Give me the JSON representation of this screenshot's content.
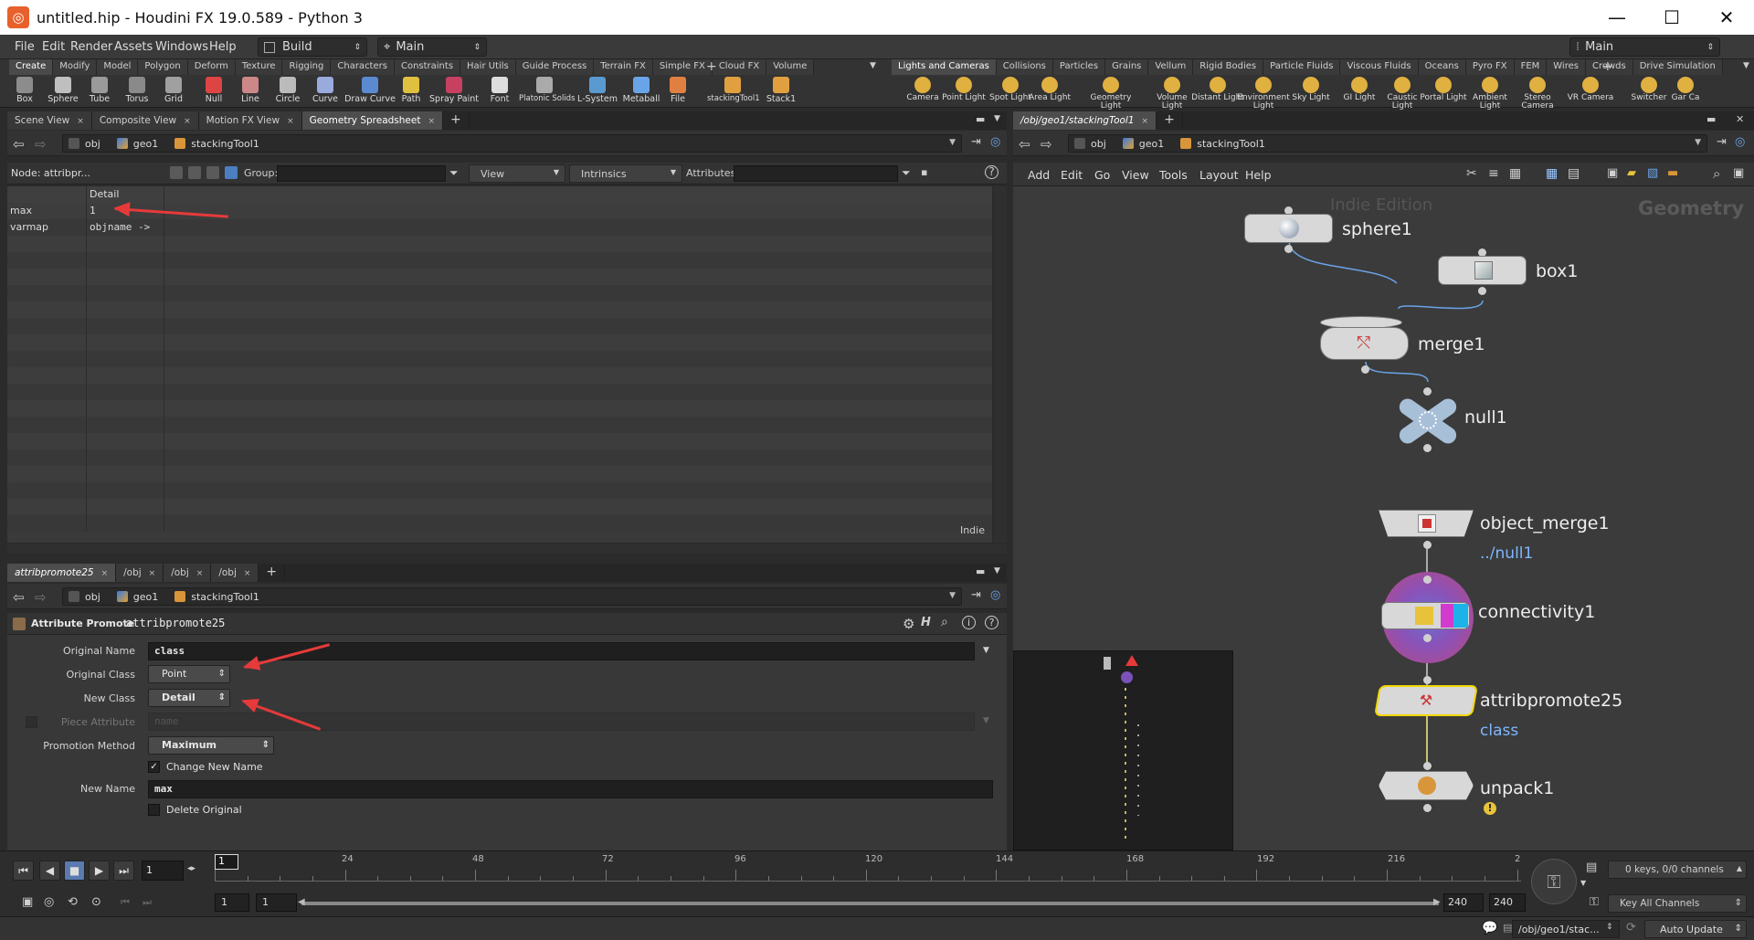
{
  "window": {
    "title": "untitled.hip - Houdini FX 19.0.589 - Python 3",
    "app_icon": "houdini-logo-icon"
  },
  "menubar": {
    "items": [
      "File",
      "Edit",
      "Render",
      "Assets",
      "Windows",
      "Help"
    ],
    "desktop": "Build",
    "desktop_icon": "build-icon",
    "context": "Main",
    "context_right": "Main"
  },
  "shelf_left": {
    "tabs": [
      "Create",
      "Modify",
      "Model",
      "Polygon",
      "Deform",
      "Texture",
      "Rigging",
      "Characters",
      "Constraints",
      "Hair Utils",
      "Guide Process",
      "Terrain FX",
      "Simple FX",
      "Cloud FX",
      "Volume"
    ],
    "tools": [
      "Box",
      "Sphere",
      "Tube",
      "Torus",
      "Grid",
      "Null",
      "Line",
      "Circle",
      "Curve",
      "Draw Curve",
      "Path",
      "Spray Paint",
      "Font",
      "Platonic Solids",
      "L-System",
      "Metaball",
      "File",
      "stackingTool1",
      "Stack1"
    ]
  },
  "shelf_right": {
    "tabs": [
      "Lights and Cameras",
      "Collisions",
      "Particles",
      "Grains",
      "Vellum",
      "Rigid Bodies",
      "Particle Fluids",
      "Viscous Fluids",
      "Oceans",
      "Pyro FX",
      "FEM",
      "Wires",
      "Crowds",
      "Drive Simulation"
    ],
    "tools": [
      "Camera",
      "Point Light",
      "Spot Light",
      "Area Light",
      "Geometry Light",
      "Volume Light",
      "Distant Light",
      "Environment Light",
      "Sky Light",
      "GI Light",
      "Caustic Light",
      "Portal Light",
      "Ambient Light",
      "Stereo Camera",
      "VR Camera",
      "Switcher",
      "Gar Ca"
    ]
  },
  "top_left_pane": {
    "tabs": [
      "Scene View",
      "Composite View",
      "Motion FX View",
      "Geometry Spreadsheet"
    ],
    "path": [
      "obj",
      "geo1",
      "stackingTool1"
    ],
    "node_label": "Node: attribpr...",
    "group_label": "Group:",
    "view_label": "View",
    "intrinsics_label": "Intrinsics",
    "attributes_label": "Attributes:",
    "spreadsheet": {
      "columns": [
        "",
        "Detail"
      ],
      "rows": [
        {
          "name": "max",
          "value": "1"
        },
        {
          "name": "varmap",
          "value": "objname ->"
        }
      ],
      "watermark": "Indie"
    }
  },
  "params_pane": {
    "tabs": [
      "attribpromote25",
      "/obj",
      "/obj",
      "/obj"
    ],
    "path": [
      "obj",
      "geo1",
      "stackingTool1"
    ],
    "node_type": "Attribute Promote",
    "node_name": "attribpromote25",
    "fields": {
      "original_name_label": "Original Name",
      "original_name": "class",
      "original_class_label": "Original Class",
      "original_class": "Point",
      "new_class_label": "New Class",
      "new_class": "Detail",
      "piece_attribute_label": "Piece Attribute",
      "piece_attribute_placeholder": "name",
      "promotion_method_label": "Promotion Method",
      "promotion_method": "Maximum",
      "change_new_name_label": "Change New Name",
      "new_name_label": "New Name",
      "new_name": "max",
      "delete_original_label": "Delete Original"
    }
  },
  "network_pane": {
    "tab": "/obj/geo1/stackingTool1",
    "path": [
      "obj",
      "geo1",
      "stackingTool1"
    ],
    "menu": [
      "Add",
      "Edit",
      "Go",
      "View",
      "Tools",
      "Layout",
      "Help"
    ],
    "watermark": "Indie Edition",
    "context_label": "Geometry",
    "nodes": [
      {
        "name": "sphere1",
        "sub": "",
        "icon": "sphere-icon"
      },
      {
        "name": "box1",
        "sub": "",
        "icon": "box-icon"
      },
      {
        "name": "merge1",
        "sub": "",
        "icon": "merge-icon"
      },
      {
        "name": "null1",
        "sub": "",
        "icon": "null-icon"
      },
      {
        "name": "object_merge1",
        "sub": "../null1",
        "icon": "object-merge-icon"
      },
      {
        "name": "connectivity1",
        "sub": "",
        "icon": "connectivity-icon"
      },
      {
        "name": "attribpromote25",
        "sub": "class",
        "icon": "attribpromote-icon"
      },
      {
        "name": "unpack1",
        "sub": "",
        "icon": "unpack-icon"
      }
    ]
  },
  "timeline": {
    "current_frame": "1",
    "frame_box": "1",
    "ticks": [
      "24",
      "48",
      "72",
      "96",
      "120",
      "144",
      "168",
      "192",
      "216",
      "2"
    ],
    "range_start": "1",
    "range_start2": "1",
    "range_end": "240",
    "range_end2": "240",
    "keys_label": "0 keys, 0/0 channels",
    "key_all_label": "Key All Channels"
  },
  "statusbar": {
    "path": "/obj/geo1/stac...",
    "update_mode": "Auto Update"
  },
  "colors": {
    "accent_selected": "#f2d700",
    "sub_label": "#7fb7ff",
    "arrow": "#e63a3a"
  }
}
